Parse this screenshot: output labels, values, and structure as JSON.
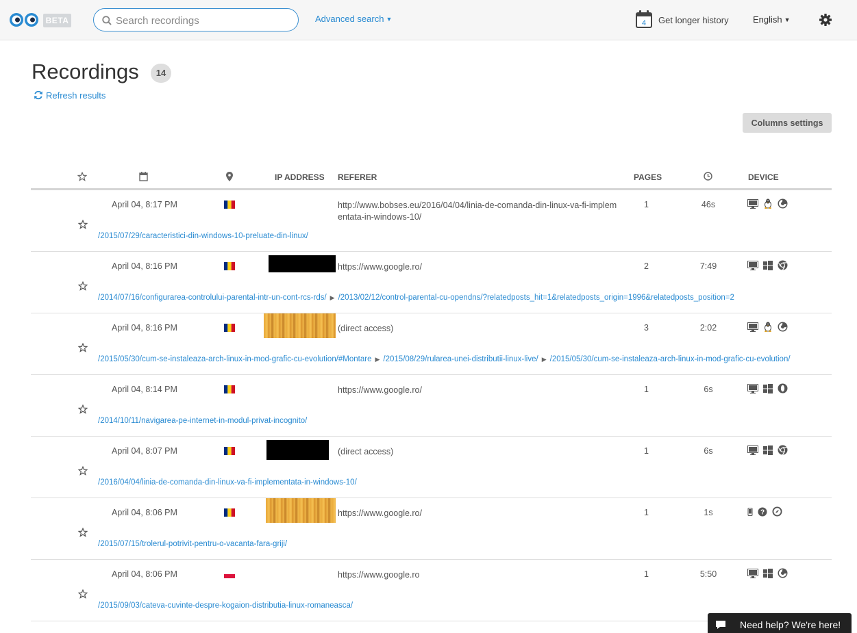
{
  "header": {
    "beta_label": "BETA",
    "search_placeholder": "Search recordings",
    "advanced_search_label": "Advanced search",
    "calendar_day": "4",
    "longer_history_label": "Get longer history",
    "language_label": "English"
  },
  "page": {
    "title": "Recordings",
    "count": "14",
    "refresh_label": "Refresh results",
    "columns_settings_label": "Columns settings"
  },
  "table": {
    "columns": {
      "ip": "IP ADDRESS",
      "referer": "REFERER",
      "pages": "PAGES",
      "device": "DEVICE"
    },
    "rows": [
      {
        "date": "April 04, 8:17 PM",
        "country": "RO",
        "referer": "http://www.bobses.eu/2016/04/04/linia-de-comanda-din-linux-va-fi-implementata-in-windows-10/",
        "pages": "1",
        "duration": "46s",
        "device": [
          "desktop",
          "linux",
          "firefox"
        ],
        "paths": [
          "/2015/07/29/caracteristici-din-windows-10-preluate-din-linux/"
        ]
      },
      {
        "date": "April 04, 8:16 PM",
        "country": "RO",
        "referer": "https://www.google.ro/",
        "pages": "2",
        "duration": "7:49",
        "device": [
          "desktop",
          "windows",
          "chrome"
        ],
        "paths": [
          "/2014/07/16/configurarea-controlului-parental-intr-un-cont-rcs-rds/",
          "/2013/02/12/control-parental-cu-opendns/?relatedposts_hit=1&relatedposts_origin=1996&relatedposts_position=2"
        ]
      },
      {
        "date": "April 04, 8:16 PM",
        "country": "RO",
        "referer": "(direct access)",
        "pages": "3",
        "duration": "2:02",
        "device": [
          "desktop",
          "linux",
          "firefox"
        ],
        "paths": [
          "/2015/05/30/cum-se-instaleaza-arch-linux-in-mod-grafic-cu-evolution/#Montare",
          "/2015/08/29/rularea-unei-distributii-linux-live/",
          "/2015/05/30/cum-se-instaleaza-arch-linux-in-mod-grafic-cu-evolution/"
        ]
      },
      {
        "date": "April 04, 8:14 PM",
        "country": "RO",
        "referer": "https://www.google.ro/",
        "pages": "1",
        "duration": "6s",
        "device": [
          "desktop",
          "windows",
          "opera"
        ],
        "paths": [
          "/2014/10/11/navigarea-pe-internet-in-modul-privat-incognito/"
        ]
      },
      {
        "date": "April 04, 8:07 PM",
        "country": "RO",
        "referer": "(direct access)",
        "pages": "1",
        "duration": "6s",
        "device": [
          "desktop",
          "windows",
          "chrome"
        ],
        "paths": [
          "/2016/04/04/linia-de-comanda-din-linux-va-fi-implementata-in-windows-10/"
        ]
      },
      {
        "date": "April 04, 8:06 PM",
        "country": "RO",
        "referer": "https://www.google.ro/",
        "pages": "1",
        "duration": "1s",
        "device": [
          "mobile",
          "unknown",
          "safari"
        ],
        "paths": [
          "/2015/07/15/trolerul-potrivit-pentru-o-vacanta-fara-griji/"
        ]
      },
      {
        "date": "April 04, 8:06 PM",
        "country": "PL",
        "referer": "https://www.google.ro",
        "pages": "1",
        "duration": "5:50",
        "device": [
          "desktop",
          "windows",
          "firefox"
        ],
        "paths": [
          "/2015/09/03/cateva-cuvinte-despre-kogaion-distributia-linux-romaneasca/"
        ]
      }
    ]
  },
  "chat": {
    "label": "Need help? We're here!"
  },
  "colors": {
    "accent": "#2a8bd2",
    "badge_bg": "#dedede",
    "button_bg": "#dcdcdc"
  }
}
